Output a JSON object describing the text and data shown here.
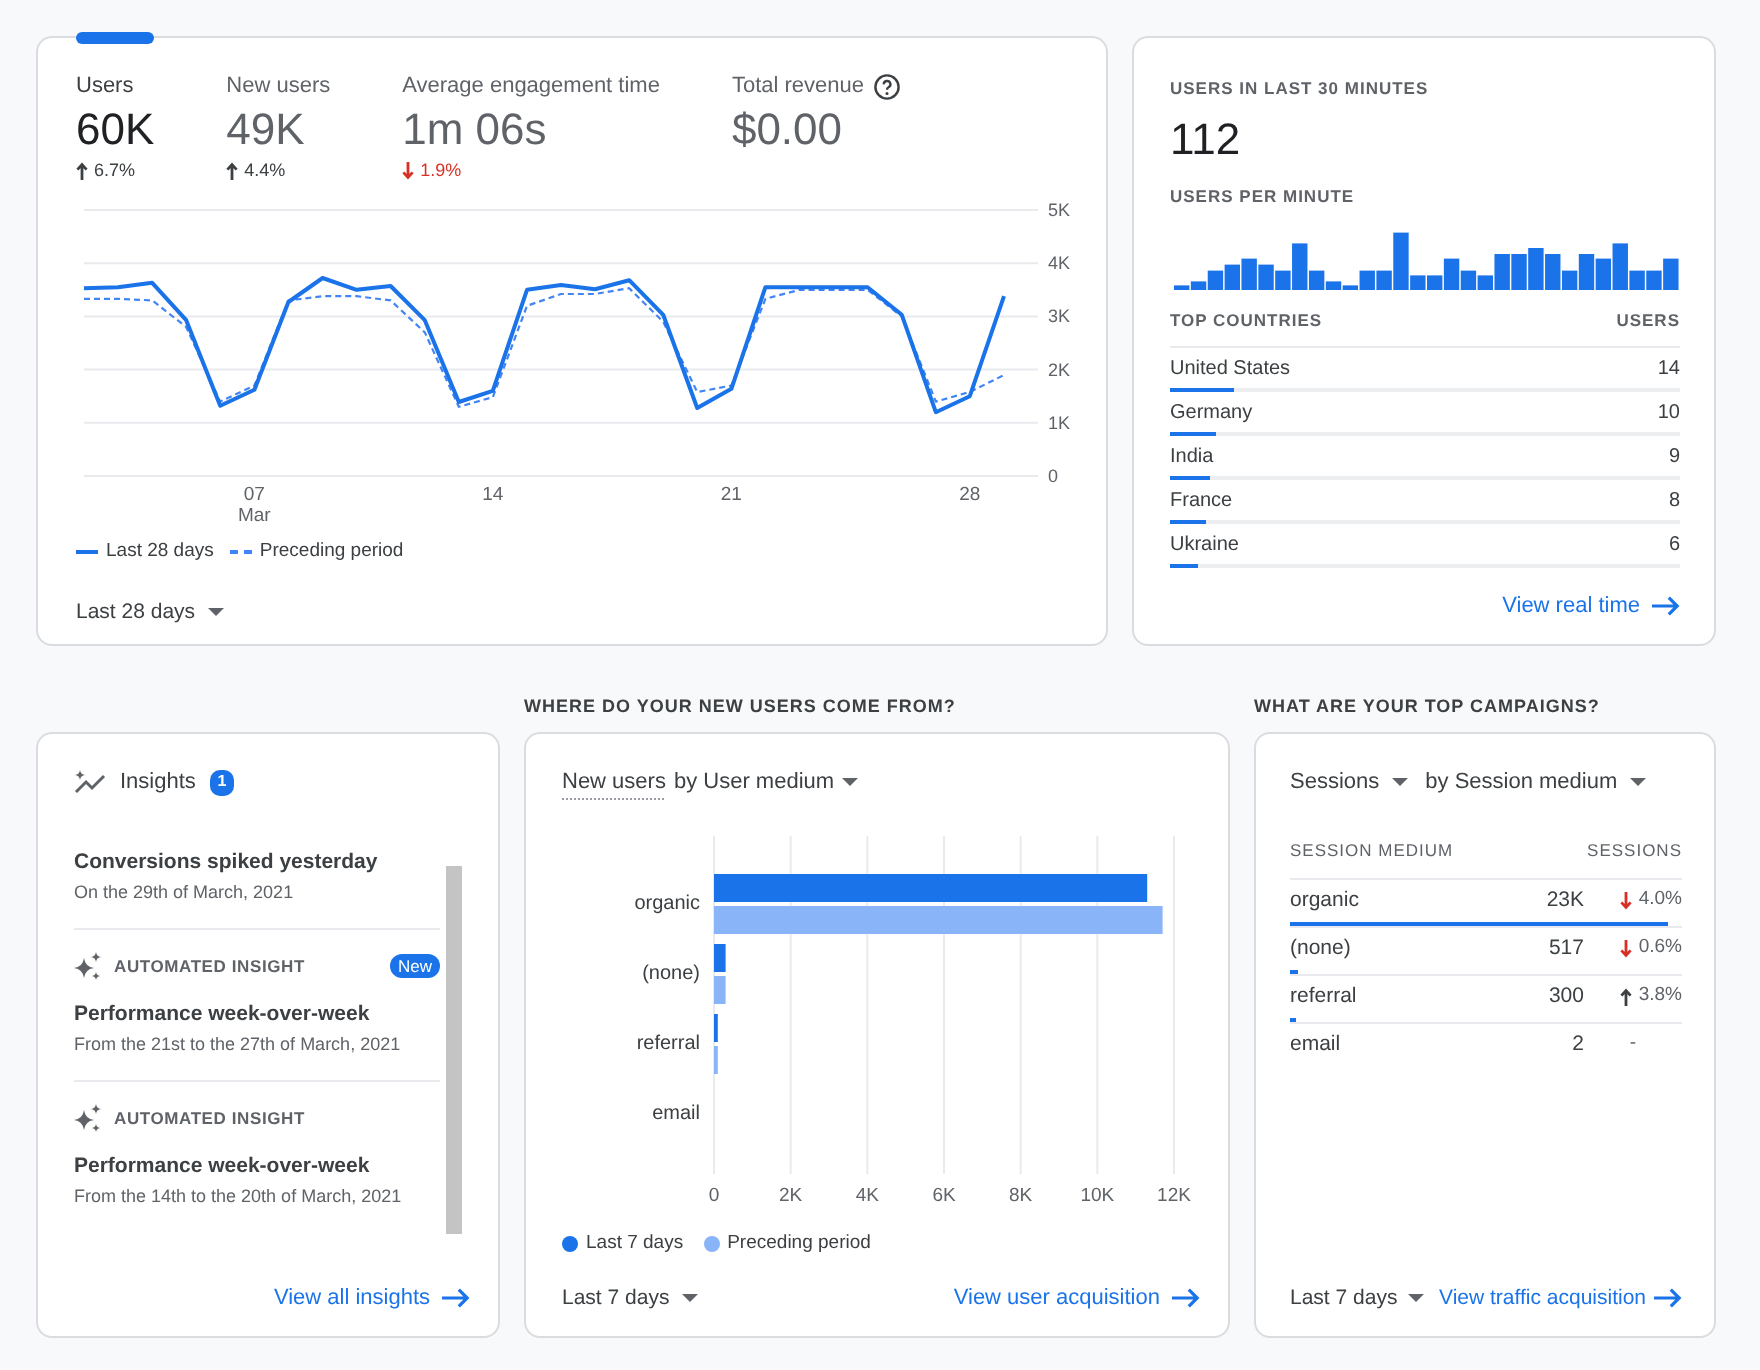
{
  "overview": {
    "tabs": [
      {
        "label": "Users",
        "value": "60K",
        "change": "6.7%",
        "decrease": false,
        "help": false,
        "selected": true
      },
      {
        "label": "New users",
        "value": "49K",
        "change": "4.4%",
        "decrease": false,
        "help": false,
        "selected": false
      },
      {
        "label": "Average engagement time",
        "value": "1m 06s",
        "change": "1.9%",
        "decrease": true,
        "help": false,
        "selected": false
      },
      {
        "label": "Total revenue",
        "value": "$0.00",
        "help": true,
        "selected": false
      }
    ],
    "chart_data": {
      "type": "line",
      "x": [
        2,
        3,
        4,
        5,
        6,
        7,
        8,
        9,
        10,
        11,
        12,
        13,
        14,
        15,
        16,
        17,
        18,
        19,
        20,
        21,
        22,
        23,
        24,
        25,
        26,
        27,
        28,
        29
      ],
      "series": [
        {
          "name": "Last 28 days",
          "color": "#1a73e8",
          "line_style": "solid",
          "values": [
            3530,
            3550,
            3630,
            2930,
            1320,
            1620,
            3270,
            3720,
            3500,
            3570,
            2930,
            1390,
            1600,
            3500,
            3590,
            3510,
            3680,
            3030,
            1280,
            1640,
            3550,
            3550,
            3550,
            3550,
            3030,
            1200,
            1500,
            3380
          ]
        },
        {
          "name": "Preceding period",
          "color": "#4285f4",
          "line_style": "dashed",
          "values": [
            3330,
            3330,
            3300,
            2800,
            1400,
            1700,
            3300,
            3380,
            3380,
            3300,
            2700,
            1300,
            1480,
            3200,
            3420,
            3420,
            3530,
            2900,
            1580,
            1700,
            3330,
            3500,
            3500,
            3500,
            3000,
            1400,
            1580,
            1900
          ]
        }
      ],
      "xlim": [
        2,
        30
      ],
      "ylim": [
        0,
        5000
      ],
      "yticks": [
        {
          "value": 0,
          "label": "0"
        },
        {
          "value": 1000,
          "label": "1K"
        },
        {
          "value": 2000,
          "label": "2K"
        },
        {
          "value": 3000,
          "label": "3K"
        },
        {
          "value": 4000,
          "label": "4K"
        },
        {
          "value": 5000,
          "label": "5K"
        }
      ],
      "xticks": [
        {
          "value": 7,
          "label": "07\nMar"
        },
        {
          "value": 14,
          "label": "14"
        },
        {
          "value": 21,
          "label": "21"
        },
        {
          "value": 28,
          "label": "28"
        }
      ],
      "grid": true
    },
    "date_range": "Last 28 days"
  },
  "realtime": {
    "title": "USERS IN LAST 30 MINUTES",
    "count": "112",
    "per_minute_label": "USERS PER MINUTE",
    "columns": [
      "TOP COUNTRIES",
      "USERS"
    ],
    "rows": [
      {
        "country": "United States",
        "users": "14",
        "level": 0.125
      },
      {
        "country": "Germany",
        "users": "10",
        "level": 0.089
      },
      {
        "country": "India",
        "users": "9",
        "level": 0.08
      },
      {
        "country": "France",
        "users": "8",
        "level": 0.071
      },
      {
        "country": "Ukraine",
        "users": "6",
        "level": 0.054
      }
    ],
    "link": "View real time"
  },
  "insights": {
    "title": "Insights",
    "badge": "1",
    "items": [
      {
        "title": "Conversions spiked yesterday",
        "subtitle": "On the 29th of March, 2021"
      },
      {
        "label": "AUTOMATED INSIGHT",
        "badge": "New",
        "title": "Performance week-over-week",
        "subtitle": "From the 21st to the 27th of March, 2021"
      },
      {
        "label": "AUTOMATED INSIGHT",
        "title": "Performance week-over-week",
        "subtitle": "From the 14th to the 20th of March, 2021"
      }
    ],
    "link": "View all insights"
  },
  "acquisition": {
    "heading": "WHERE DO YOUR NEW USERS COME FROM?",
    "dropdown": {
      "metric": "New users",
      "dimension": "by User medium"
    },
    "chart_data": {
      "type": "bar",
      "orientation": "horizontal",
      "categories": [
        "organic",
        "(none)",
        "referral",
        "email"
      ],
      "series": [
        {
          "name": "Last 7 days",
          "color": "#1a73e8",
          "values": [
            11300,
            300,
            100,
            0
          ]
        },
        {
          "name": "Preceding period",
          "color": "#8ab4f8",
          "values": [
            11700,
            300,
            100,
            0
          ]
        }
      ],
      "xlim": [
        0,
        12000
      ],
      "xticks": [
        {
          "value": 0,
          "label": "0"
        },
        {
          "value": 2000,
          "label": "2K"
        },
        {
          "value": 4000,
          "label": "4K"
        },
        {
          "value": 6000,
          "label": "6K"
        },
        {
          "value": 8000,
          "label": "8K"
        },
        {
          "value": 10000,
          "label": "10K"
        },
        {
          "value": 12000,
          "label": "12K"
        }
      ],
      "grid": true
    },
    "date_range": "Last 7 days",
    "link": "View user acquisition"
  },
  "campaigns": {
    "heading": "WHAT ARE YOUR TOP CAMPAIGNS?",
    "metric_dropdown": "Sessions",
    "dimension_dropdown": "by Session medium",
    "columns": [
      "SESSION MEDIUM",
      "SESSIONS"
    ],
    "rows": [
      {
        "medium": "organic",
        "sessions": "23K",
        "decrease": true,
        "change": "4.0%",
        "level": 0.966
      },
      {
        "medium": "(none)",
        "sessions": "517",
        "decrease": true,
        "change": "0.6%",
        "level": 0.022
      },
      {
        "medium": "referral",
        "sessions": "300",
        "decrease": false,
        "change": "3.8%",
        "level": 0.013
      },
      {
        "medium": "email",
        "sessions": "2",
        "change": "-"
      }
    ],
    "date_range": "Last 7 days",
    "link": "View traffic acquisition"
  }
}
